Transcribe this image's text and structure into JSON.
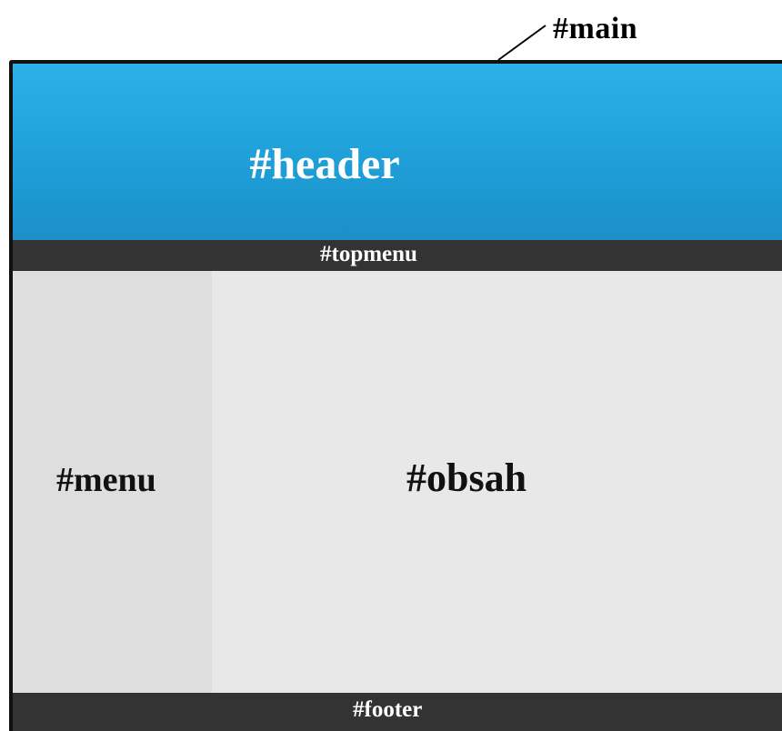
{
  "diagram": {
    "annotation": {
      "main_label": "#main"
    },
    "regions": {
      "header": {
        "label": "#header",
        "color": "#1f9fd8"
      },
      "topmenu": {
        "label": "#topmenu",
        "color": "#333333"
      },
      "menu": {
        "label": "#menu",
        "color": "#dedede"
      },
      "obsah": {
        "label": "#obsah",
        "color": "#e8e8e8"
      },
      "footer": {
        "label": "#footer",
        "color": "#333333"
      }
    },
    "frame_color": "#111111"
  }
}
